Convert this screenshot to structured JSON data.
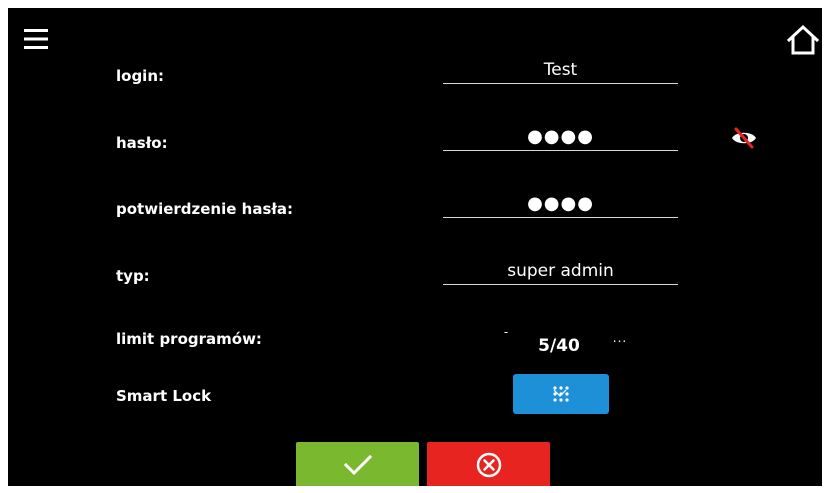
{
  "header": {
    "menu_icon": "hamburger-menu-icon",
    "home_icon": "home-icon"
  },
  "form": {
    "login": {
      "label": "login:",
      "value": "Test"
    },
    "password": {
      "label": "hasło:",
      "value": "●●●●",
      "visibility_icon": "eye-off-icon"
    },
    "password_confirm": {
      "label": "potwierdzenie hasła:",
      "value": "●●●●"
    },
    "type": {
      "label": "typ:",
      "value": "super admin"
    },
    "program_limit": {
      "label": "limit programów:",
      "decrement": "-",
      "value": "5/40",
      "increment": "...",
      "decrement_symbol_size_hint": "small",
      "increment_symbol_size_hint": "small"
    },
    "smart_lock": {
      "label": "Smart Lock",
      "button_icon": "keypad-icon"
    }
  },
  "actions": {
    "confirm_icon": "checkmark-icon",
    "cancel_icon": "cancel-icon"
  },
  "colors": {
    "background": "#000000",
    "text": "#ffffff",
    "smart_lock_button": "#1e90d8",
    "confirm_button": "#7ab82f",
    "cancel_button": "#e82421"
  }
}
